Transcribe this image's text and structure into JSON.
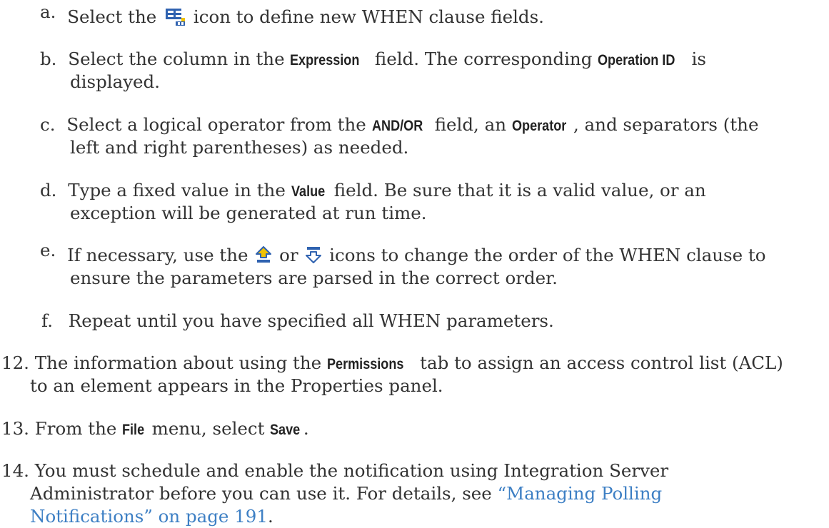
{
  "steps": {
    "a": {
      "marker": "a.",
      "pre": "Select the",
      "icon": "add-when-clause-icon",
      "post": "icon to define new WHEN clause fields."
    },
    "b": {
      "marker": "b.",
      "t1": "Select the column in the",
      "k1": "Expression",
      "t2": "field. The corresponding",
      "k2": "Operation ID",
      "t3": "is",
      "line2": "displayed."
    },
    "c": {
      "marker": "c.",
      "t1": "Select a logical operator from the",
      "k1": "AND/OR",
      "t2": "field, an",
      "k2": "Operator",
      "t3": ", and separators (the",
      "line2": "left and right parentheses) as needed."
    },
    "d": {
      "marker": "d.",
      "t1": "Type a fixed value in the",
      "k1": "Value",
      "t2": "field. Be sure that it is a valid value, or an",
      "line2": "exception will be generated at run time."
    },
    "e": {
      "marker": "e.",
      "pre": "If necessary, use the",
      "icon_up": "move-up-icon",
      "mid": "or",
      "icon_down": "move-down-icon",
      "post": "icons to change the order of the WHEN clause to",
      "line2": "ensure the parameters are parsed in the correct order."
    },
    "f": {
      "marker": "f.",
      "text": "Repeat until you have specified all WHEN parameters."
    },
    "s12": {
      "marker": "12.",
      "t1": "The information about using the",
      "k1": "Permissions",
      "t2": "tab to assign an access control list (ACL)",
      "line2": "to an element appears in the Properties panel."
    },
    "s13": {
      "marker": "13.",
      "t1": "From the",
      "k1": "File",
      "t2": "menu, select",
      "k2": "Save",
      "t3": "."
    },
    "s14": {
      "marker": "14.",
      "line1": "You must schedule and enable the notification using Integration Server",
      "line2_pre": "Administrator before you can use it. For details, see",
      "link_line2": "“Managing Polling",
      "link_line3": "Notifications” on page 191",
      "line3_post": "."
    }
  },
  "colors": {
    "body_text": "#333333",
    "link": "#3d7fc4",
    "icon_blue": "#2f62b0",
    "icon_yellow": "#f2c200"
  }
}
